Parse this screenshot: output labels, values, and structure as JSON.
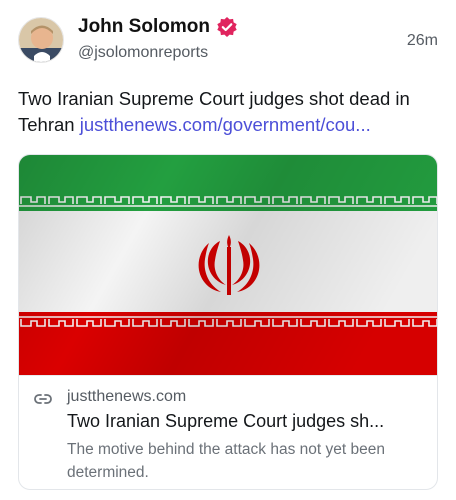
{
  "author": {
    "display_name": "John Solomon",
    "handle": "@jsolomonreports",
    "verified_icon": "verified-badge-icon",
    "avatar_icon": "avatar"
  },
  "post": {
    "timestamp": "26m",
    "text": "Two Iranian Supreme Court judges shot dead in Tehran ",
    "link_text": "justthenews.com/government/cou..."
  },
  "card": {
    "image_icon": "iran-flag-image",
    "link_icon": "link-icon",
    "domain": "justthenews.com",
    "title": "Two Iranian Supreme Court judges sh...",
    "description": "The motive behind the attack has not yet been determined."
  },
  "colors": {
    "verified": "#e0245e",
    "link": "#4c4fd8",
    "flag_green": "#239f40",
    "flag_red": "#da0000"
  }
}
